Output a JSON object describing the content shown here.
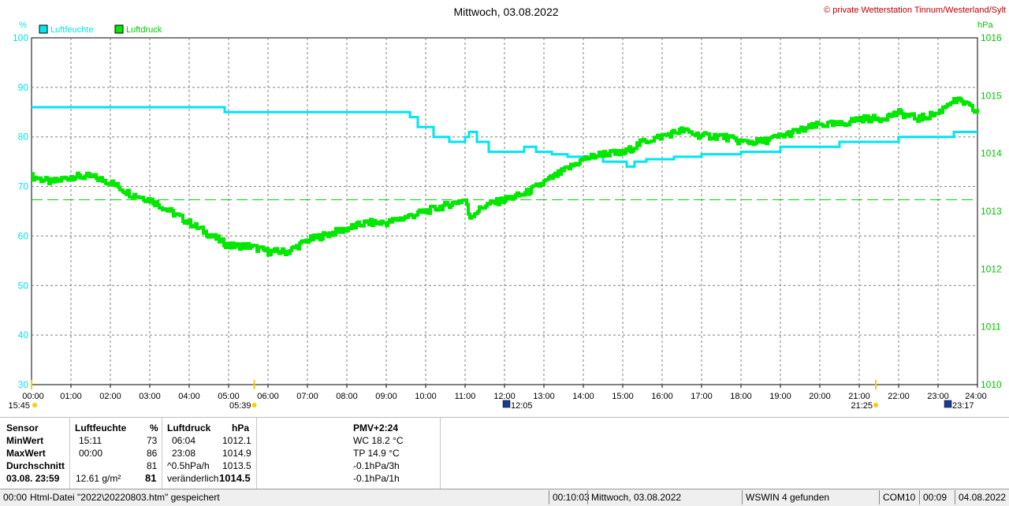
{
  "chart_data": {
    "type": "line",
    "title": "Mittwoch, 03.08.2022",
    "credit": "© private Wetterstation Tinnum/Westerland/Sylt",
    "legend": [
      "Luftfeuchte",
      "Luftdruck"
    ],
    "colors": {
      "humidity": "#00e5ee",
      "pressure": "#00e800",
      "reference": "#00c800"
    },
    "left_axis": {
      "unit": "%",
      "min": 30,
      "max": 100,
      "ticks": [
        "30",
        "40",
        "50",
        "60",
        "70",
        "80",
        "90",
        "100"
      ]
    },
    "right_axis": {
      "unit": "hPa",
      "min": 1010,
      "max": 1016,
      "ticks": [
        "1010",
        "1011",
        "1012",
        "1013",
        "1014",
        "1015",
        "1016"
      ]
    },
    "x_ticks": [
      "00:00",
      "01:00",
      "02:00",
      "03:00",
      "04:00",
      "05:00",
      "06:00",
      "07:00",
      "08:00",
      "09:00",
      "10:00",
      "11:00",
      "12:00",
      "13:00",
      "14:00",
      "15:00",
      "16:00",
      "17:00",
      "18:00",
      "19:00",
      "20:00",
      "21:00",
      "22:00",
      "23:00",
      "24:00"
    ],
    "events": [
      {
        "hour": 0.0,
        "label": "15:45"
      },
      {
        "hour": 5.65,
        "label": "05:39"
      },
      {
        "hour": 12.08,
        "label": "12:05"
      },
      {
        "hour": 21.42,
        "label": "21:25"
      },
      {
        "hour": 23.28,
        "label": "23:17"
      }
    ],
    "grid": true,
    "reference_line_hpa": 1013.2,
    "series": [
      {
        "name": "Luftfeuchte",
        "axis": "left",
        "x": [
          0,
          4.9,
          4.9,
          9.4,
          9.6,
          9.8,
          10.2,
          10.4,
          10.6,
          11.0,
          11.1,
          11.3,
          11.6,
          12.0,
          12.5,
          12.8,
          13.1,
          13.2,
          13.6,
          14.2,
          14.5,
          14.9,
          15.1,
          15.3,
          15.6,
          16.0,
          16.3,
          16.6,
          17.0,
          17.5,
          18.0,
          18.5,
          19.0,
          19.3,
          19.8,
          20.5,
          21.0,
          21.2,
          21.5,
          22.0,
          22.5,
          23.0,
          23.4,
          24.0
        ],
        "y": [
          86,
          86,
          85,
          85,
          84,
          82,
          80,
          80,
          79,
          80,
          81,
          79,
          77,
          77,
          78,
          77,
          77,
          76.5,
          76,
          76,
          75,
          75,
          74,
          75,
          75.5,
          75.5,
          76,
          76,
          76.5,
          76.5,
          77,
          77,
          78,
          78,
          78,
          79,
          79,
          79,
          79,
          80,
          80,
          80,
          81,
          81
        ]
      },
      {
        "name": "Luftdruck",
        "axis": "right",
        "x": [
          0,
          0.5,
          1.0,
          1.5,
          2.0,
          2.5,
          3.0,
          3.5,
          4.0,
          4.5,
          5.0,
          5.5,
          6.0,
          6.5,
          7.0,
          7.5,
          8.0,
          8.5,
          9.0,
          9.5,
          10.0,
          10.5,
          11.0,
          11.1,
          11.5,
          12.0,
          12.5,
          13.0,
          13.5,
          14.0,
          14.5,
          15.0,
          15.5,
          16.0,
          16.5,
          17.0,
          17.5,
          18.0,
          18.5,
          19.0,
          19.5,
          20.0,
          20.5,
          21.0,
          21.5,
          22.0,
          22.5,
          23.0,
          23.3,
          23.6,
          24.0
        ],
        "y": [
          1013.6,
          1013.5,
          1013.6,
          1013.6,
          1013.5,
          1013.3,
          1013.2,
          1013.0,
          1012.8,
          1012.6,
          1012.4,
          1012.4,
          1012.3,
          1012.3,
          1012.5,
          1012.6,
          1012.7,
          1012.8,
          1012.8,
          1012.9,
          1013.0,
          1013.1,
          1013.2,
          1012.9,
          1013.1,
          1013.2,
          1013.3,
          1013.5,
          1013.7,
          1013.9,
          1014.0,
          1014.0,
          1014.2,
          1014.3,
          1014.4,
          1014.3,
          1014.3,
          1014.2,
          1014.2,
          1014.3,
          1014.4,
          1014.5,
          1014.5,
          1014.6,
          1014.6,
          1014.7,
          1014.6,
          1014.7,
          1014.9,
          1014.9,
          1014.7
        ]
      }
    ]
  },
  "stats": {
    "hdr_sensor": "Sensor",
    "hdr_hum": "Luftfeuchte",
    "hdr_hum_unit": "%",
    "hdr_pres": "Luftdruck",
    "hdr_pres_unit": "hPa",
    "row_min": "MinWert",
    "row_max": "MaxWert",
    "row_avg": "Durchschnitt",
    "row_now": "03.08. 23:59",
    "hum_min_time": "15:11",
    "hum_min_val": "73",
    "hum_max_time": "00:00",
    "hum_max_val": "86",
    "hum_avg_val": "81",
    "hum_now_abs": "12.61 g/m²",
    "hum_now_val": "81",
    "pres_min_time": "06:04",
    "pres_min_val": "1012.1",
    "pres_max_time": "23:08",
    "pres_max_val": "1014.9",
    "pres_trend": "^0.5hPa/h",
    "pres_avg_val": "1013.5",
    "pres_state": "veränderlich",
    "pres_now_val": "1014.5",
    "pmv": "PMV+2:24",
    "wc": "WC 18.2 °C",
    "tp": "TP 14.9 °C",
    "trend3h": "-0.1hPa/3h",
    "trend1h": "-0.1hPa/1h"
  },
  "status": {
    "html_time": "00:00",
    "html_msg": "Html-Datei  \"2022\\20220803.htm\"  gespeichert",
    "elapsed": "00:10:03",
    "date": "Mittwoch, 03.08.2022",
    "found": "WSWIN 4 gefunden",
    "port": "COM10",
    "clock": "00:09",
    "today": "04.08.2022"
  }
}
